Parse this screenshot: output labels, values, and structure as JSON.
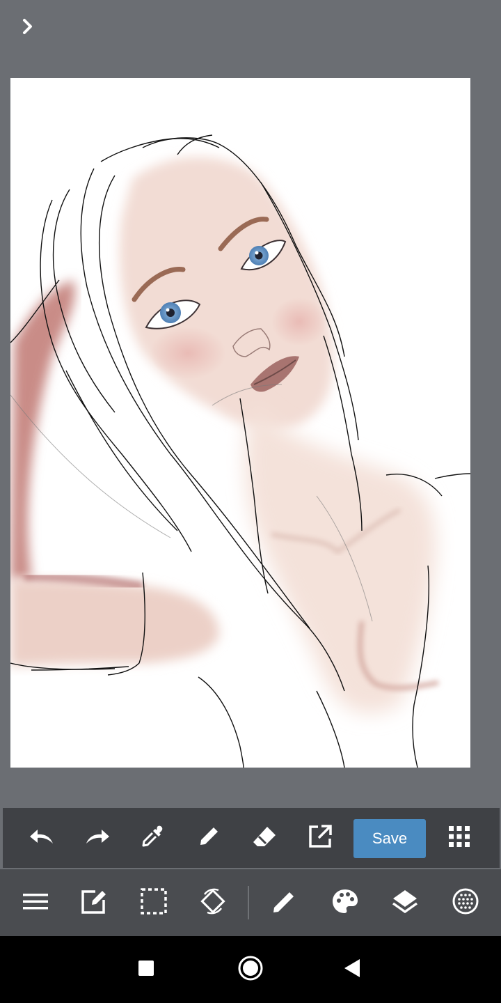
{
  "toolbar": {
    "save_label": "Save",
    "accent_color": "#4a8bc1"
  },
  "icons": {
    "expand": "chevron-right-icon",
    "top_tools": [
      "undo-icon",
      "redo-icon",
      "eyedropper-icon",
      "pen-icon",
      "eraser-icon",
      "export-icon",
      "save-button",
      "grid-menu-icon"
    ],
    "bottom_tools": [
      "menu-icon",
      "edit-icon",
      "selection-icon",
      "rotate-icon",
      "brush-icon",
      "palette-icon",
      "layers-icon",
      "material-icon"
    ],
    "nav": [
      "recents-icon",
      "home-icon",
      "back-icon"
    ]
  }
}
